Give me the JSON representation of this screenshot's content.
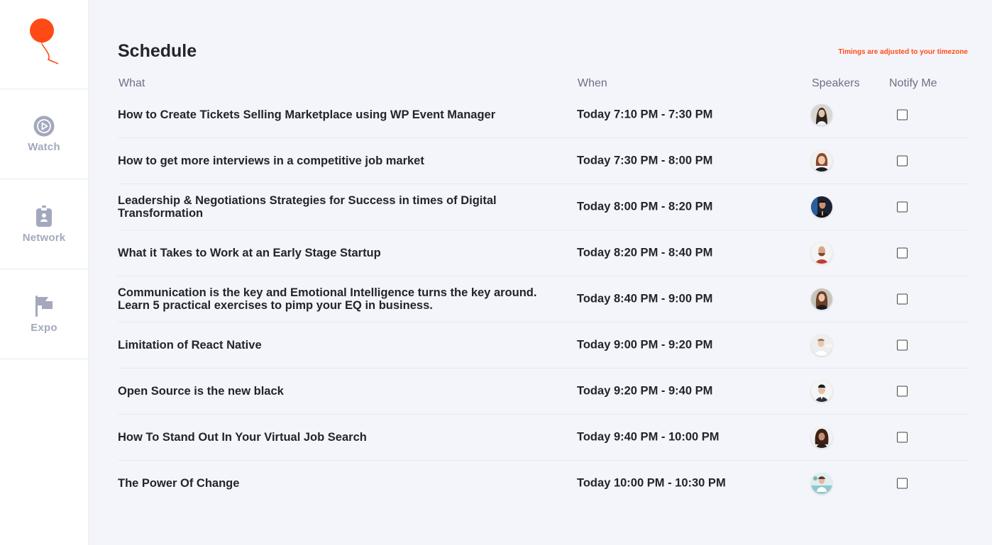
{
  "sidebar": {
    "logo": "balloon-logo",
    "nav": [
      {
        "label": "Watch",
        "icon": "play-icon"
      },
      {
        "label": "Network",
        "icon": "badge-icon"
      },
      {
        "label": "Expo",
        "icon": "flag-icon"
      }
    ]
  },
  "schedule": {
    "title": "Schedule",
    "timezone_note": "Timings are adjusted to your timezone",
    "columns": {
      "what": "What",
      "when": "When",
      "speakers": "Speakers",
      "notify": "Notify Me"
    },
    "sessions": [
      {
        "what": "How to Create Tickets Selling Marketplace using WP Event Manager",
        "when": "Today 7:10 PM - 7:30 PM",
        "notify": false
      },
      {
        "what": "How to get more interviews in a competitive job market",
        "when": "Today 7:30 PM - 8:00 PM",
        "notify": false
      },
      {
        "what": "Leadership & Negotiations Strategies for Success in times of Digital Transformation",
        "when": "Today 8:00 PM - 8:20 PM",
        "notify": false
      },
      {
        "what": "What it Takes to Work at an Early Stage Startup",
        "when": "Today 8:20 PM - 8:40 PM",
        "notify": false
      },
      {
        "what": "Communication is the key and Emotional Intelligence turns the key around. Learn 5 practical exercises to pimp your EQ in business.",
        "when": "Today 8:40 PM - 9:00 PM",
        "notify": false
      },
      {
        "what": "Limitation of React Native",
        "when": "Today 9:00 PM - 9:20 PM",
        "notify": false
      },
      {
        "what": "Open Source is the new black",
        "when": "Today 9:20 PM - 9:40 PM",
        "notify": false
      },
      {
        "what": "How To Stand Out In Your Virtual Job Search",
        "when": "Today 9:40 PM - 10:00 PM",
        "notify": false
      },
      {
        "what": "The Power Of Change",
        "when": "Today 10:00 PM - 10:30 PM",
        "notify": false
      }
    ]
  },
  "colors": {
    "accent": "#ff4a17",
    "nav_icon": "#a3a8bd",
    "background": "#f4f5fa"
  }
}
